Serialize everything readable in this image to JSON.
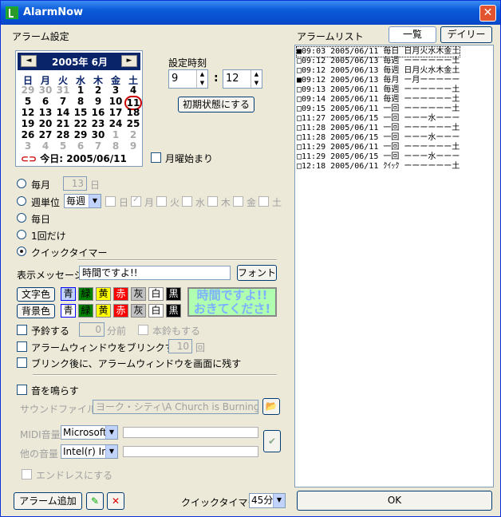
{
  "title": "AlarmNow",
  "left_heading": "アラーム設定",
  "right_heading": "アラームリスト",
  "tabs": {
    "list": "一覧",
    "daily": "デイリー"
  },
  "calendar": {
    "month_label": "2005年 6月",
    "prev": "◄",
    "next": "►",
    "dow": [
      "日",
      "月",
      "火",
      "水",
      "木",
      "金",
      "土"
    ],
    "weeks": [
      [
        "29",
        "30",
        "31",
        "1",
        "2",
        "3",
        "4"
      ],
      [
        "5",
        "6",
        "7",
        "8",
        "9",
        "10",
        "11"
      ],
      [
        "12",
        "13",
        "14",
        "15",
        "16",
        "17",
        "18"
      ],
      [
        "19",
        "20",
        "21",
        "22",
        "23",
        "24",
        "25"
      ],
      [
        "26",
        "27",
        "28",
        "29",
        "30",
        "1",
        "2"
      ],
      [
        "3",
        "4",
        "5",
        "6",
        "7",
        "8",
        "9"
      ]
    ],
    "today": "今日: 2005/06/11"
  },
  "time": {
    "label": "設定時刻",
    "hour": "9",
    "colon": ":",
    "minute": "12",
    "reset_button": "初期状態にする"
  },
  "monday_start": "月曜始まり",
  "modes": {
    "monthly": "毎月",
    "monthly_day": "13",
    "monthly_unit": "日",
    "weekly": "週単位",
    "weekly_select": "毎週",
    "weekdays": [
      "日",
      "月",
      "火",
      "水",
      "木",
      "金",
      "土"
    ],
    "daily": "毎日",
    "once": "1回だけ",
    "quick": "クイックタイマー"
  },
  "message": {
    "label": "表示メッセージ",
    "value": "時間ですよ!!",
    "font_button": "フォント"
  },
  "colors": {
    "text_label": "文字色",
    "bg_label": "背景色",
    "names": [
      "青",
      "緑",
      "黄",
      "赤",
      "灰",
      "白",
      "黒"
    ],
    "swatches": [
      "#0000ff",
      "#008000",
      "#ffff00",
      "#ff0000",
      "#c0c0c0",
      "#ffffff",
      "#000000"
    ],
    "preview_text": "時間ですよ!!",
    "preview_text2": "おきてくださ!"
  },
  "prealarm": {
    "label": "予鈴する",
    "value": "0",
    "unit": "分前",
    "label2": "本鈴もする"
  },
  "blink": {
    "label": "アラームウィンドウをブリンクする",
    "value": "10",
    "unit": "回"
  },
  "blink_after": "ブリンク後に、アラームウィンドウを画面に残す",
  "sound": {
    "label": "音を鳴らす",
    "file_label": "サウンドファイル",
    "file_value": "ヨーク・シティ\\A Church is Burning.WAV",
    "midi_label": "MIDI音量",
    "midi_device": "Microsoft",
    "other_label": "他の音量",
    "other_device": "Intel(r) Inte",
    "endless": "エンドレスにする"
  },
  "bottom": {
    "add_button": "アラーム追加",
    "quick_label": "クイックタイマー",
    "quick_value": "45分",
    "ok": "OK"
  },
  "alarms": [
    "■09:03 2005/06/11 毎日 日月火水木金土",
    "□09:12 2005/06/13 毎週 ーーーーーー土",
    "□09:12 2005/06/13 毎週 日月火水木金土",
    "■09:12 2005/06/13 毎月 ー月ーーーーー",
    "□09:13 2005/06/11 毎週 ーーーーーー土",
    "□09:14 2005/06/11 毎週 ーーーーーー土",
    "□09:15 2005/06/11 一回 ーーーーーー土",
    "□11:27 2005/06/15 一回 ーーー水ーーー",
    "□11:28 2005/06/11 一回 ーーーーーー土",
    "□11:28 2005/06/15 一回 ーーー水ーーー",
    "□11:29 2005/06/11 一回 ーーーーーー土",
    "□11:29 2005/06/15 一回 ーーー水ーーー",
    "□12:18 2005/06/11 ｸｲｯｸ ーーーーーー土"
  ]
}
